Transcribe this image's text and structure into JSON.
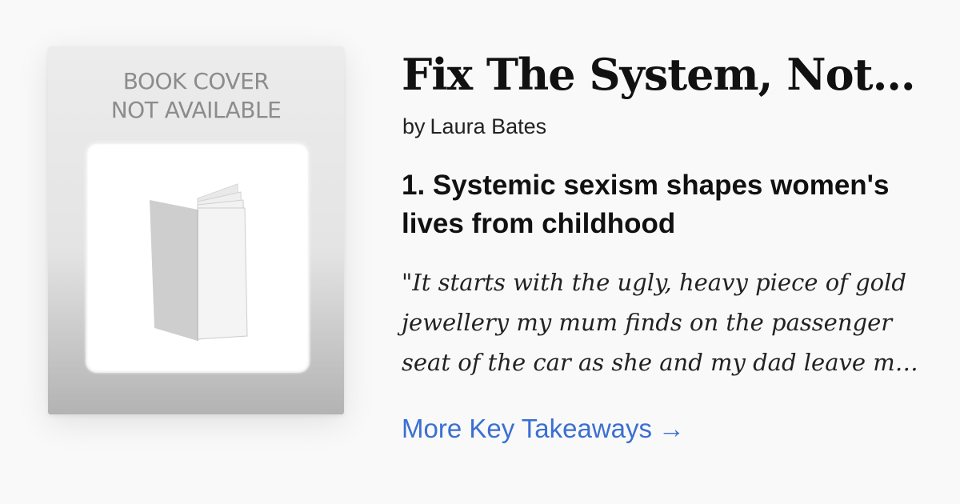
{
  "book": {
    "title": "Fix The System, Not…",
    "author_prefix": "by",
    "author": "Laura Bates"
  },
  "cover": {
    "placeholder_line1": "BOOK COVER",
    "placeholder_line2": "NOT AVAILABLE",
    "icon": "open-book-icon"
  },
  "takeaway": {
    "heading": "1. Systemic sexism shapes women's lives from childhood",
    "quote": "\"It starts with the ugly, heavy piece of gold jewellery my mum finds on the passenger seat of the car as she and my dad leave m…"
  },
  "link": {
    "label": "More Key Takeaways",
    "arrow": "→",
    "color": "#3b6fd1"
  }
}
